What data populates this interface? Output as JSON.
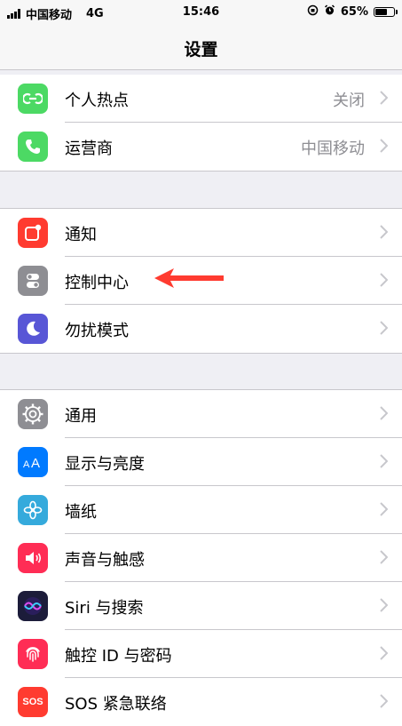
{
  "status": {
    "carrier": "中国移动",
    "network": "4G",
    "time": "15:46",
    "battery": "65%",
    "battery_level": 0.65
  },
  "nav": {
    "title": "设置"
  },
  "groups": [
    [
      {
        "label": "个人热点",
        "value": "关闭",
        "icon": "hotspot-icon",
        "color": "#4cd964"
      },
      {
        "label": "运营商",
        "value": "中国移动",
        "icon": "phone-icon",
        "color": "#4cd964"
      }
    ],
    [
      {
        "label": "通知",
        "value": "",
        "icon": "notification-icon",
        "color": "#ff3b30"
      },
      {
        "label": "控制中心",
        "value": "",
        "icon": "control-center-icon",
        "color": "#8e8e93"
      },
      {
        "label": "勿扰模式",
        "value": "",
        "icon": "moon-icon",
        "color": "#5856d6"
      }
    ],
    [
      {
        "label": "通用",
        "value": "",
        "icon": "gear-icon",
        "color": "#8e8e93"
      },
      {
        "label": "显示与亮度",
        "value": "",
        "icon": "display-brightness-icon",
        "color": "#007aff"
      },
      {
        "label": "墙纸",
        "value": "",
        "icon": "wallpaper-icon",
        "color": "#35aadc"
      },
      {
        "label": "声音与触感",
        "value": "",
        "icon": "sound-icon",
        "color": "#ff2d55"
      },
      {
        "label": "Siri 与搜索",
        "value": "",
        "icon": "siri-icon",
        "color": "#1c1c3a"
      },
      {
        "label": "触控 ID 与密码",
        "value": "",
        "icon": "fingerprint-icon",
        "color": "#ff2d55"
      },
      {
        "label": "SOS 紧急联络",
        "value": "",
        "icon": "sos-icon",
        "color": "#ff3b30",
        "icon_text": "SOS"
      }
    ]
  ],
  "annotation_color": "#ff3b30"
}
